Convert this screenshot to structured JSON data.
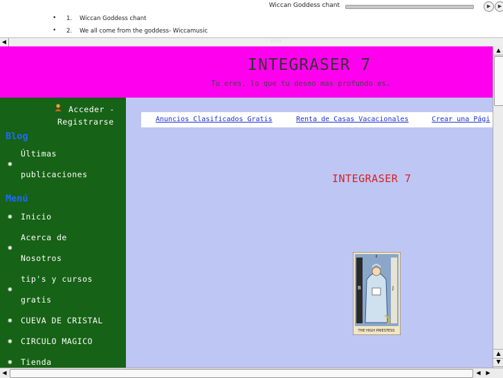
{
  "player": {
    "now_playing": "Wiccan Goddess chant",
    "play_icon": "play-icon",
    "next_icon": "next-icon"
  },
  "playlist": [
    {
      "num": "1.",
      "title": "Wiccan Goddess chant"
    },
    {
      "num": "2.",
      "title": "We all come from the goddess- Wiccamusic"
    }
  ],
  "header": {
    "title": "INTEGRASER 7",
    "tagline": "Tu eres, lo que tu deseo mas profundo es."
  },
  "sidebar": {
    "login_icon": "user-login-icon",
    "login_line1": "Acceder -",
    "login_line2": "Registrarse",
    "blog_heading": "Blog",
    "blog_item_line1": "Últimas",
    "blog_item_line2": "publicaciones",
    "menu_heading": "Menú",
    "menu": {
      "inicio": "Inicio",
      "acerca_line1": "Acerca de",
      "acerca_line2": "Nosotros",
      "tips_line1": "tip's y cursos",
      "tips_line2": "gratis",
      "cueva": "CUEVA DE CRISTAL",
      "circulo": "CIRCULO MAGICO",
      "tienda": "Tienda"
    }
  },
  "main": {
    "ads": [
      "Anuncios Clasificados Gratis",
      "Renta de Casas Vacacionales",
      "Crear una Pági"
    ],
    "title": "INTEGRASER 7",
    "tarot_caption": "THE HIGH PRIESTESS"
  },
  "colors": {
    "header_bg": "#ff00ee",
    "sidebar_bg": "#166216",
    "main_bg": "#bec6f4",
    "heading_blue": "#1f6bff",
    "title_red": "#d82020",
    "link_blue": "#1b2fd8"
  }
}
